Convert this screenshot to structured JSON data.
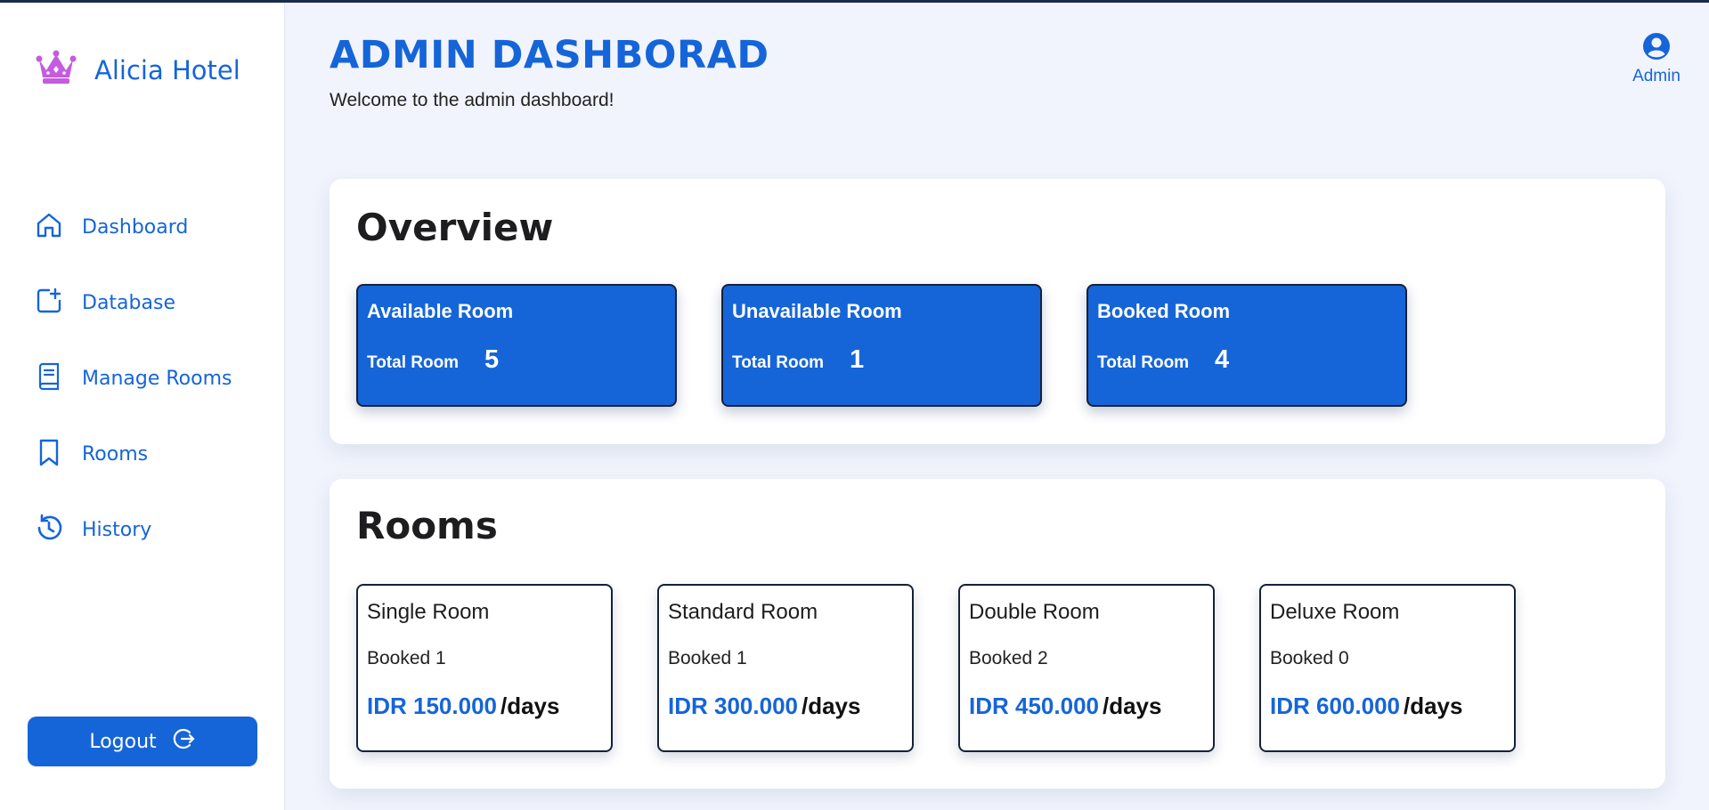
{
  "brand": {
    "name": "Alicia Hotel",
    "icon": "crown-icon"
  },
  "nav": {
    "items": [
      {
        "label": "Dashboard",
        "icon": "home-icon"
      },
      {
        "label": "Database",
        "icon": "add-document-icon"
      },
      {
        "label": "Manage Rooms",
        "icon": "book-icon"
      },
      {
        "label": "Rooms",
        "icon": "bookmark-icon"
      },
      {
        "label": "History",
        "icon": "history-icon"
      }
    ],
    "logout_label": "Logout"
  },
  "header": {
    "title": "ADMIN DASHBORAD",
    "subtitle": "Welcome to the admin dashboard!",
    "user_label": "Admin"
  },
  "overview": {
    "title": "Overview",
    "cards": [
      {
        "title": "Available Room",
        "sub_label": "Total Room",
        "value": "5"
      },
      {
        "title": "Unavailable Room",
        "sub_label": "Total Room",
        "value": "1"
      },
      {
        "title": "Booked Room",
        "sub_label": "Total Room",
        "value": "4"
      }
    ]
  },
  "rooms": {
    "title": "Rooms",
    "cards": [
      {
        "name": "Single Room",
        "booked": "Booked 1",
        "price": "IDR 150.000",
        "unit": "/days"
      },
      {
        "name": "Standard Room",
        "booked": "Booked 1",
        "price": "IDR 300.000",
        "unit": "/days"
      },
      {
        "name": "Double Room",
        "booked": "Booked 2",
        "price": "IDR 450.000",
        "unit": "/days"
      },
      {
        "name": "Deluxe Room",
        "booked": "Booked 0",
        "price": "IDR 600.000",
        "unit": "/days"
      }
    ]
  },
  "colors": {
    "accent": "#1565d8",
    "background": "#f1f4fd",
    "crown": "#c45be0"
  }
}
